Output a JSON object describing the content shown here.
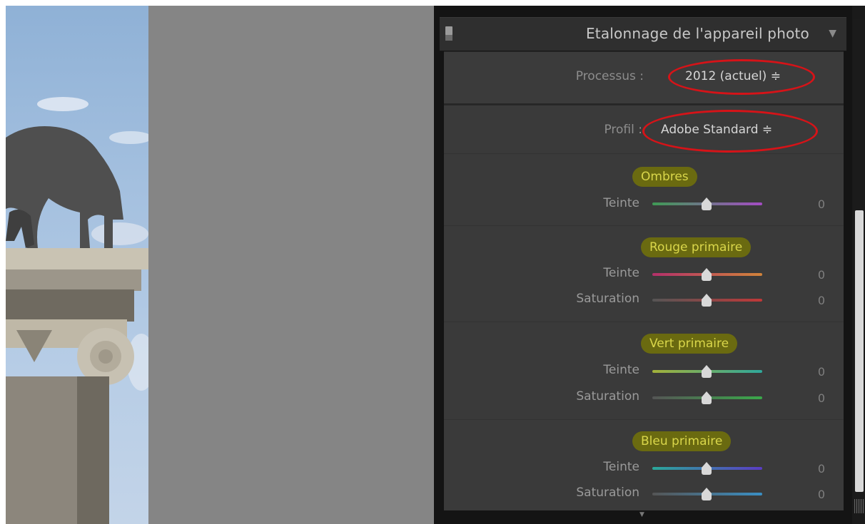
{
  "panel": {
    "title": "Etalonnage de l'appareil photo",
    "collapse_icon": "▼"
  },
  "process": {
    "label": "Processus :",
    "value": "2012 (actuel) ≑"
  },
  "profile": {
    "label": "Profil :",
    "value": "Adobe Standard ≑"
  },
  "groups": {
    "ombres": {
      "title": "Ombres",
      "rows": [
        {
          "label": "Teinte",
          "value": "0"
        }
      ]
    },
    "rouge": {
      "title": "Rouge primaire",
      "rows": [
        {
          "label": "Teinte",
          "value": "0"
        },
        {
          "label": "Saturation",
          "value": "0"
        }
      ]
    },
    "vert": {
      "title": "Vert primaire",
      "rows": [
        {
          "label": "Teinte",
          "value": "0"
        },
        {
          "label": "Saturation",
          "value": "0"
        }
      ]
    },
    "bleu": {
      "title": "Bleu primaire",
      "rows": [
        {
          "label": "Teinte",
          "value": "0"
        },
        {
          "label": "Saturation",
          "value": "0"
        }
      ]
    }
  },
  "colors": {
    "panel_bg": "#3a3a3a",
    "annotation_red": "#d61318",
    "highlight_bg": "#6a6a10",
    "highlight_text": "#d9d64a"
  }
}
